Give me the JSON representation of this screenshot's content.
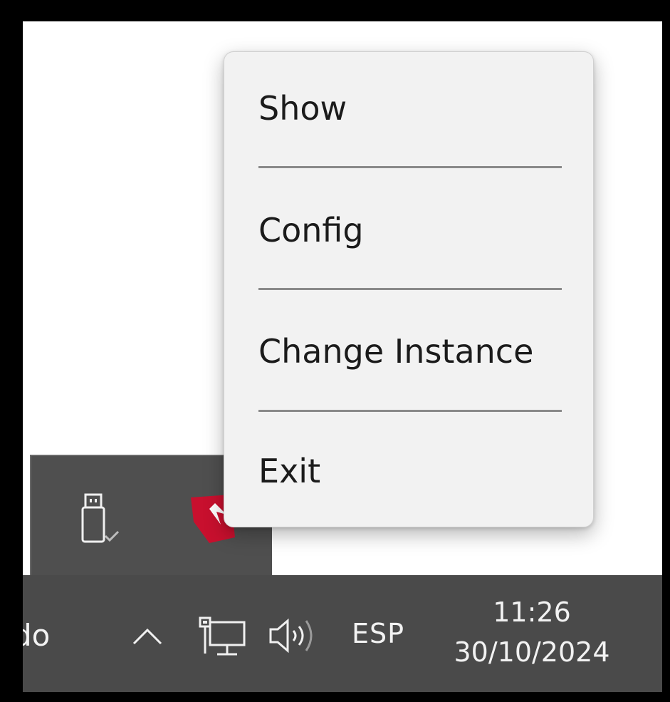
{
  "context_menu": {
    "items": [
      {
        "label": "Show"
      },
      {
        "label": "Config"
      },
      {
        "label": "Change Instance"
      },
      {
        "label": "Exit"
      }
    ]
  },
  "tray_overflow": {
    "icons": [
      "usb-safely-remove-icon",
      "app-tray-icon"
    ]
  },
  "taskbar": {
    "cut_text": "do",
    "language": "ESP",
    "time": "11:26",
    "date": "30/10/2024",
    "icons": [
      "chevron-up-icon",
      "network-icon",
      "volume-icon"
    ]
  },
  "colors": {
    "taskbar": "#4a4a4a",
    "menu_bg": "#f2f2f2",
    "app_icon_red": "#c8102e"
  }
}
